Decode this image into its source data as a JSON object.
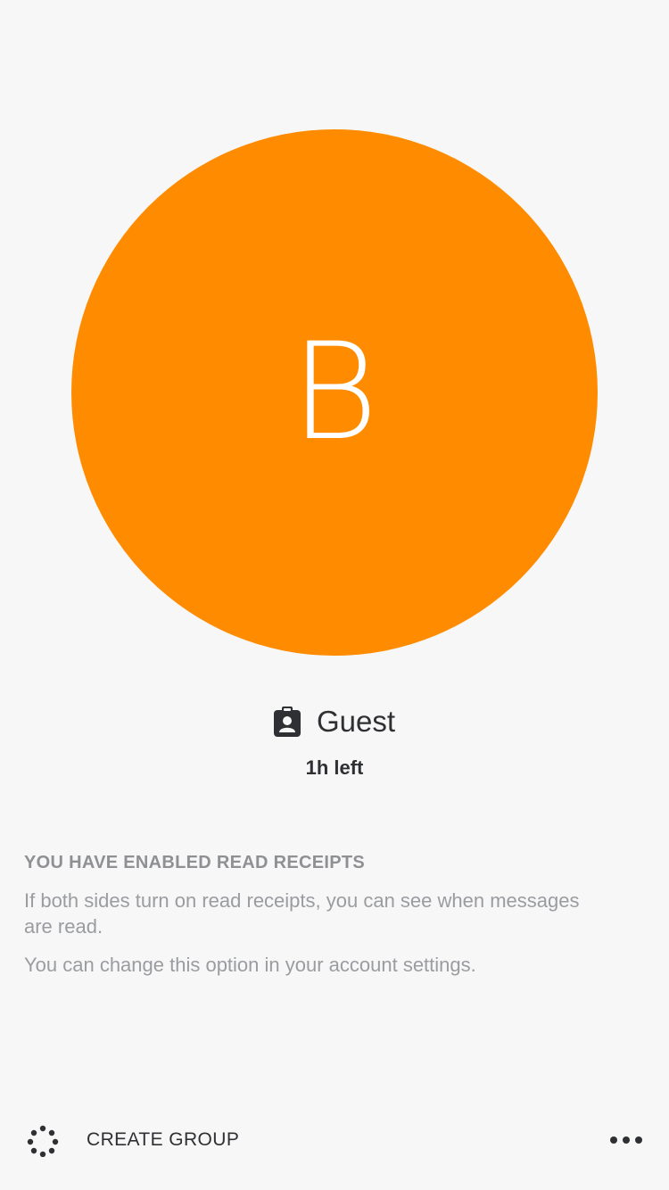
{
  "profile": {
    "initial": "B",
    "avatar_color": "#ff8c00",
    "badge_icon": "guest-badge-icon",
    "name": "Guest",
    "time_left": "1h left"
  },
  "read_receipts": {
    "heading": "YOU HAVE ENABLED READ RECEIPTS",
    "description": "If both sides turn on read receipts, you can see when messages are read.",
    "settings_note": "You can change this option in your account settings."
  },
  "footer": {
    "group_icon": "create-group-icon",
    "create_group_label": "CREATE GROUP",
    "more_icon": "more-options-icon"
  }
}
